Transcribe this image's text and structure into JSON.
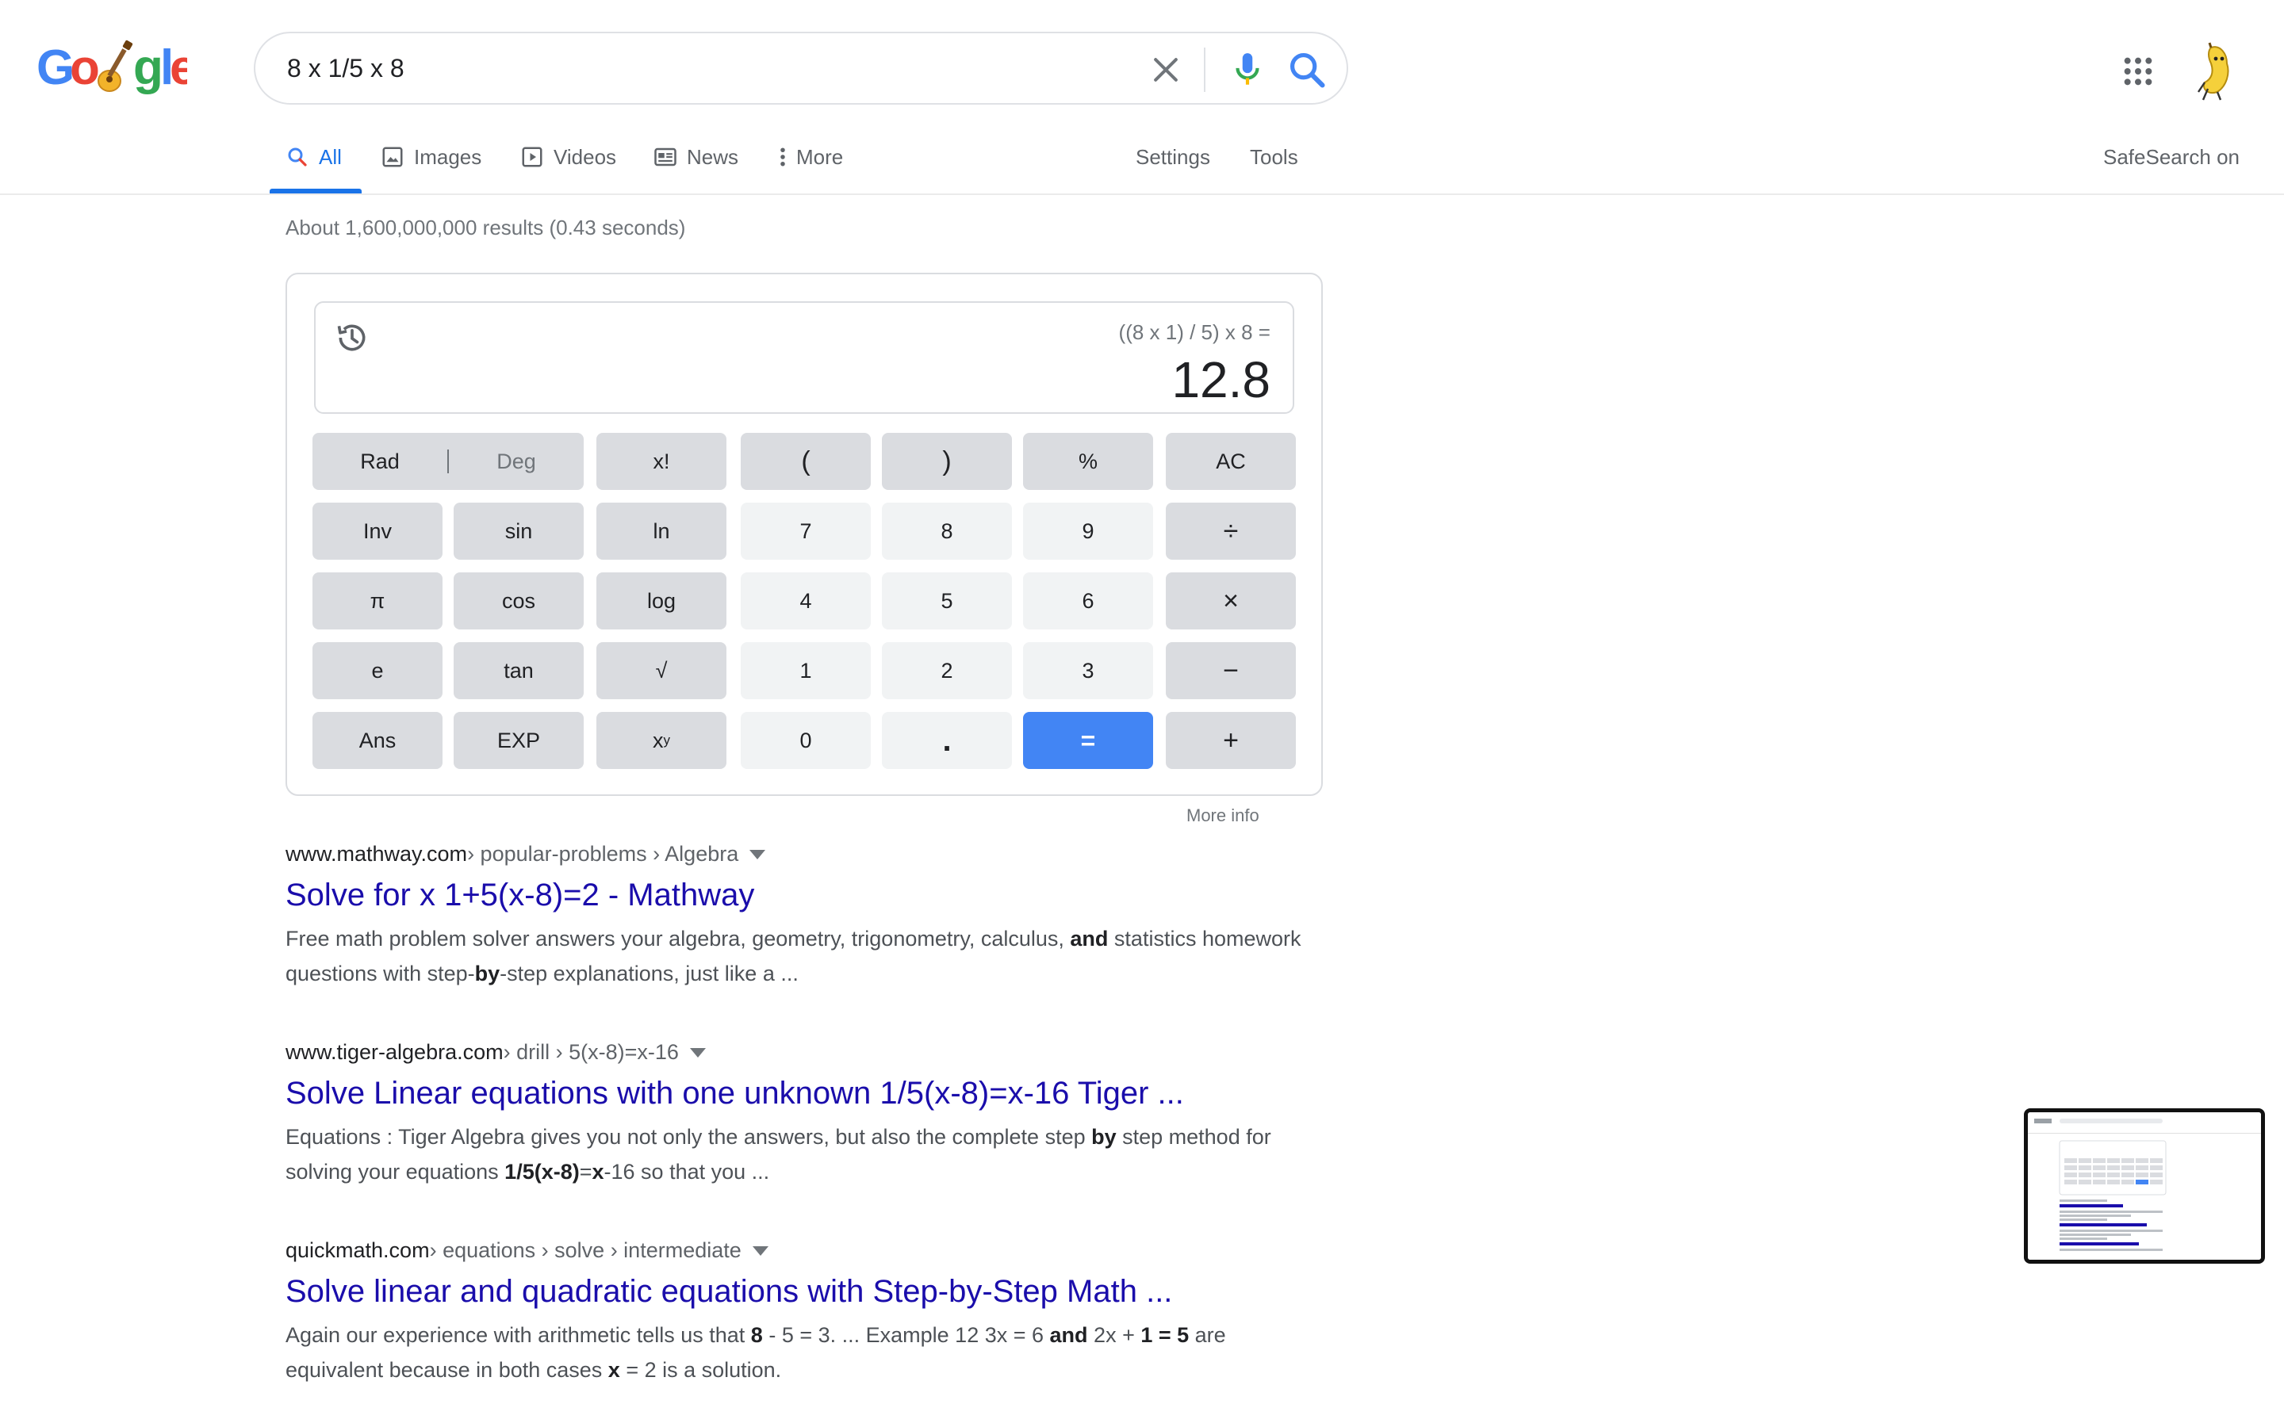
{
  "search": {
    "query": "8 x 1/5 x 8"
  },
  "tabs": [
    {
      "label": "All",
      "icon": "search-icon"
    },
    {
      "label": "Images",
      "icon": "image-icon"
    },
    {
      "label": "Videos",
      "icon": "video-icon"
    },
    {
      "label": "News",
      "icon": "news-icon"
    },
    {
      "label": "More",
      "icon": "more-vert-icon"
    }
  ],
  "tools": {
    "settings": "Settings",
    "tools": "Tools"
  },
  "safesearch": "SafeSearch on",
  "result_stats": "About 1,600,000,000 results (0.43 seconds)",
  "calculator": {
    "expression": "((8 x 1) / 5) x 8 =",
    "result": "12.8",
    "rad": "Rad",
    "deg": "Deg",
    "keys": [
      [
        "x!",
        "(",
        ")",
        "%",
        "AC"
      ],
      [
        "Inv",
        "sin",
        "ln",
        "7",
        "8",
        "9",
        "÷"
      ],
      [
        "π",
        "cos",
        "log",
        "4",
        "5",
        "6",
        "×"
      ],
      [
        "e",
        "tan",
        "√",
        "1",
        "2",
        "3",
        "−"
      ],
      [
        "Ans",
        "EXP",
        "x",
        "0",
        ".",
        "=",
        "+"
      ]
    ],
    "pow_sup": "y",
    "more_info": "More info"
  },
  "results": [
    {
      "host": "www.mathway.com",
      "path": " › popular-problems › Algebra",
      "title": "Solve for x 1+5(x-8)=2 - Mathway",
      "snippet": [
        {
          "t": "Free math problem solver answers your algebra, geometry, trigonometry, calculus, ",
          "b": false
        },
        {
          "t": "and",
          "b": true
        },
        {
          "t": " statistics homework questions with step-",
          "b": false
        },
        {
          "t": "by",
          "b": true
        },
        {
          "t": "-step explanations, just like a ...",
          "b": false
        }
      ]
    },
    {
      "host": "www.tiger-algebra.com",
      "path": " › drill › 5(x-8)=x-16",
      "title": "Solve Linear equations with one unknown 1/5(x-8)=x-16 Tiger ...",
      "snippet": [
        {
          "t": "Equations : Tiger Algebra gives you not only the answers, but also the complete step ",
          "b": false
        },
        {
          "t": "by",
          "b": true
        },
        {
          "t": " step method for solving your equations ",
          "b": false
        },
        {
          "t": "1/5(x-8)",
          "b": true
        },
        {
          "t": "=",
          "b": false
        },
        {
          "t": "x",
          "b": true
        },
        {
          "t": "-16 so that you ...",
          "b": false
        }
      ]
    },
    {
      "host": "quickmath.com",
      "path": " › equations › solve › intermediate",
      "title": "Solve linear and quadratic equations with Step-by-Step Math ...",
      "snippet": [
        {
          "t": "Again our experience with arithmetic tells us that ",
          "b": false
        },
        {
          "t": "8",
          "b": true
        },
        {
          "t": " - 5 = 3. ... Example 12 3x = 6 ",
          "b": false
        },
        {
          "t": "and",
          "b": true
        },
        {
          "t": " 2x + ",
          "b": false
        },
        {
          "t": "1 = 5",
          "b": true
        },
        {
          "t": " are equivalent because in both cases ",
          "b": false
        },
        {
          "t": "x",
          "b": true
        },
        {
          "t": " = 2 is a solution.",
          "b": false
        }
      ]
    }
  ],
  "colors": {
    "link": "#1a0dab",
    "accent": "#1a73e8",
    "equals_key": "#4285f4"
  }
}
